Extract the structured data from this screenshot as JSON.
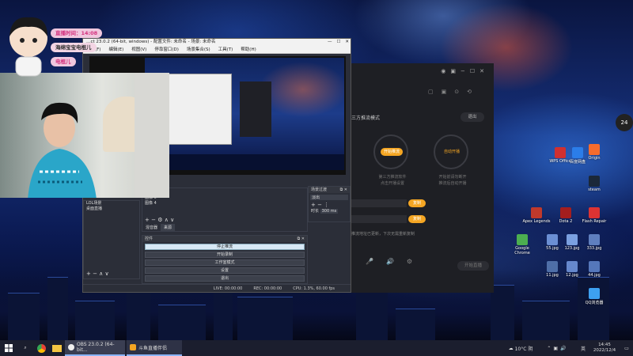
{
  "badge": {
    "live_time": "直播时间：14:08",
    "line2": "海绵宝宝电棍儿",
    "line3": "电棍儿"
  },
  "obs": {
    "title": "…ct 23.0.2 (64-bit, windows) - 配置文件: 未命名 - 场景: 未命名",
    "menu": [
      "文件(F)",
      "编辑(E)",
      "视图(V)",
      "停靠窗口(D)",
      "场景集合(S)",
      "工具(T)",
      "帮助(H)"
    ],
    "sources_items": [
      "游戏捕获 2",
      "图像 5",
      "图像 4"
    ],
    "scenes_items": [
      "LOL场景",
      "桌面直播"
    ],
    "tab_mixer": "混音器",
    "tab_sources": "来源",
    "transitions_title": "场景过渡",
    "transition_value": "淡出",
    "duration_label": "时长",
    "duration_value": "300 ms",
    "controls_title": "控件",
    "controls": [
      "停止推流",
      "开始录制",
      "工作室模式",
      "设置",
      "退出"
    ],
    "status": [
      "LIVE: 00:00:00",
      "REC: 00:00:00",
      "CPU: 1.3%, 60.00 fps"
    ]
  },
  "darkapp": {
    "mode_title": "三方推流模式",
    "exit_btn": "退出",
    "start_push": "开始推流",
    "start_push2": "自动开播",
    "desc1": "第三方推流软件",
    "desc2": "点击开播设置",
    "desc3": "开始前请勿断开",
    "desc4": "推流后自动开播",
    "copy": "复制",
    "copy2": "复制",
    "note": "推流地址已更新，下次无需重新复制",
    "bottom_btn": "开始直播"
  },
  "desktop_icons": [
    {
      "label": "steam",
      "color": "#1b2838"
    },
    {
      "label": "Origin",
      "color": "#f56c2d"
    },
    {
      "label": "Apex Legends",
      "color": "#c0392b"
    },
    {
      "label": "Dota 2",
      "color": "#a41e1e"
    },
    {
      "label": "Flash Repair",
      "color": "#d33"
    },
    {
      "label": "Google Chrome",
      "color": "#4caf50"
    },
    {
      "label": "55.jpg",
      "color": "#6b8fd4"
    },
    {
      "label": "123.jpg",
      "color": "#7aa0e0"
    },
    {
      "label": "333.jpg",
      "color": "#5f7fbf"
    },
    {
      "label": "11.jpg",
      "color": "#4f6fa8"
    },
    {
      "label": "12.jpg",
      "color": "#6688cc"
    },
    {
      "label": "44.jpg",
      "color": "#5577bb"
    },
    {
      "label": "QQ浏览器",
      "color": "#3da0f0"
    },
    {
      "label": "WPS Office",
      "color": "#d03030"
    },
    {
      "label": "百度网盘",
      "color": "#2b7de9"
    }
  ],
  "taskbar": {
    "obs_task": "OBS 23.0.2 (64-bit...",
    "app_task": "斗鱼直播伴侣",
    "weather": "10°C 阴",
    "lang": "英",
    "time": "14:45",
    "date": "2022/12/4"
  },
  "side_badge": "24"
}
